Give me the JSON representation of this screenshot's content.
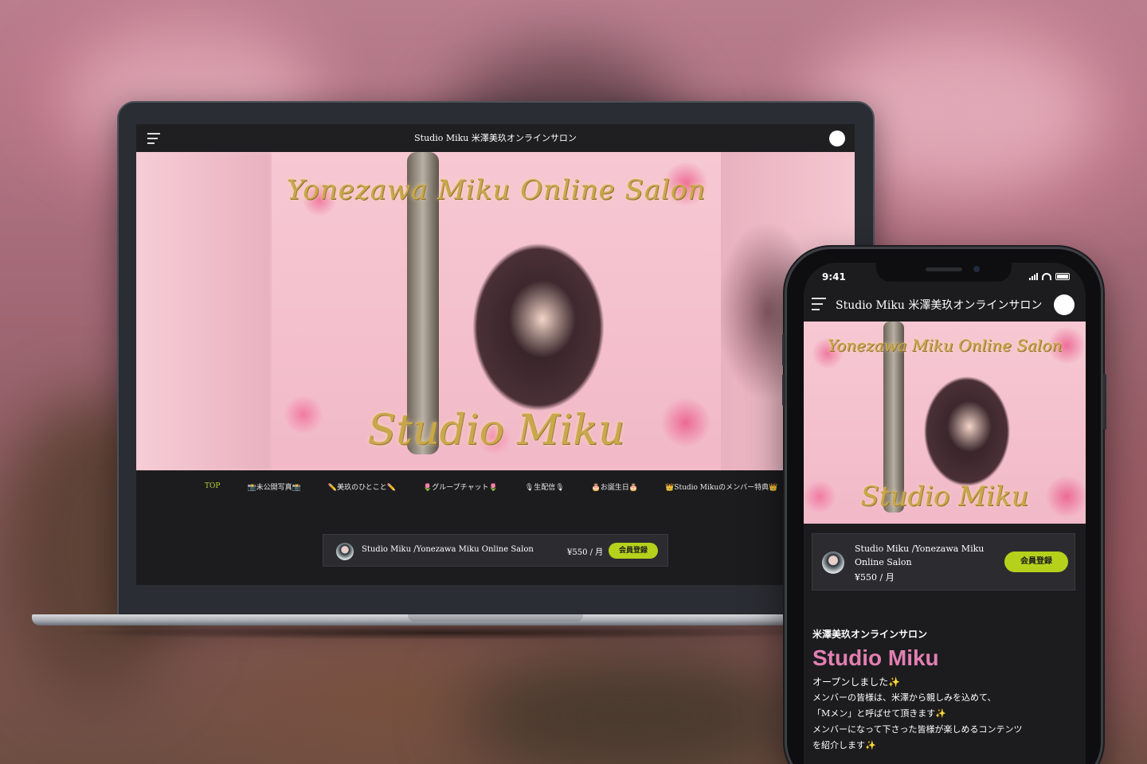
{
  "desktop": {
    "header": {
      "title": "Studio Miku 米澤美玖オンラインサロン"
    },
    "hero": {
      "script_top": "Yonezawa Miku Online Salon",
      "script_bottom": "Studio Miku"
    },
    "nav": {
      "items": [
        {
          "label": "TOP",
          "active": true
        },
        {
          "label": "📸未公開写真📸",
          "active": false
        },
        {
          "label": "✏️美玖のひとこと✏️",
          "active": false
        },
        {
          "label": "🌷グループチャット🌷",
          "active": false
        },
        {
          "label": "🎙生配信🎙",
          "active": false
        },
        {
          "label": "🎂お誕生日🎂",
          "active": false
        },
        {
          "label": "👑Studio Mikuのメンバー特典👑",
          "active": false
        }
      ]
    },
    "plan": {
      "name": "Studio Miku /Yonezawa Miku Online Salon",
      "price": "¥550 / 月",
      "button": "会員登録"
    }
  },
  "mobile": {
    "status": {
      "time": "9:41"
    },
    "header": {
      "title": "Studio Miku 米澤美玖オンラインサロン"
    },
    "hero": {
      "script_top": "Yonezawa Miku Online Salon",
      "script_bottom": "Studio Miku"
    },
    "plan": {
      "name": "Studio Miku /Yonezawa Miku Online Salon",
      "price": "¥550 / 月",
      "button": "会員登録"
    },
    "body": {
      "subtitle": "米澤美玖オンラインサロン",
      "title": "Studio Miku",
      "lines": [
        "オープンしました✨",
        "メンバーの皆様は、米澤から親しみを込めて、",
        "「Mメン」と呼ばせて頂きます✨",
        "メンバーになって下さった皆様が楽しめるコンテンツ",
        "を紹介します✨"
      ]
    }
  },
  "colors": {
    "accent_green": "#b6d11c",
    "title_pink": "#e27fb2",
    "dark_bg": "#1c1c1e"
  },
  "icons": [
    "hamburger-menu-icon",
    "avatar-icon",
    "signal-icon",
    "wifi-icon",
    "battery-icon"
  ]
}
